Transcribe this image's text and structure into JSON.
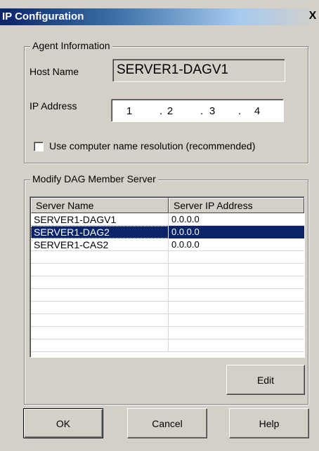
{
  "window": {
    "title": "IP Configuration",
    "close_glyph": "X"
  },
  "agent_info": {
    "legend": "Agent Information",
    "host_name_label": "Host Name",
    "host_name_value": "SERVER1-DAGV1",
    "ip_address_label": "IP Address",
    "ip_octets": [
      "1",
      "2",
      "3",
      "4"
    ],
    "use_name_resolution_label": "Use computer name resolution (recommended)",
    "use_name_resolution_checked": false
  },
  "dag_members": {
    "legend": "Modify DAG Member Server",
    "columns": [
      "Server Name",
      "Server IP Address"
    ],
    "rows": [
      {
        "name": "SERVER1-DAGV1",
        "ip": "0.0.0.0",
        "selected": false
      },
      {
        "name": "SERVER1-DAG2",
        "ip": "0.0.0.0",
        "selected": true
      },
      {
        "name": "SERVER1-CAS2",
        "ip": "0.0.0.0",
        "selected": false
      }
    ],
    "edit_label": "Edit"
  },
  "footer": {
    "ok_label": "OK",
    "cancel_label": "Cancel",
    "help_label": "Help"
  },
  "colors": {
    "dialog_bg": "#d4d0c8",
    "title_bar": "#0a246a",
    "selection": "#0a246a"
  }
}
